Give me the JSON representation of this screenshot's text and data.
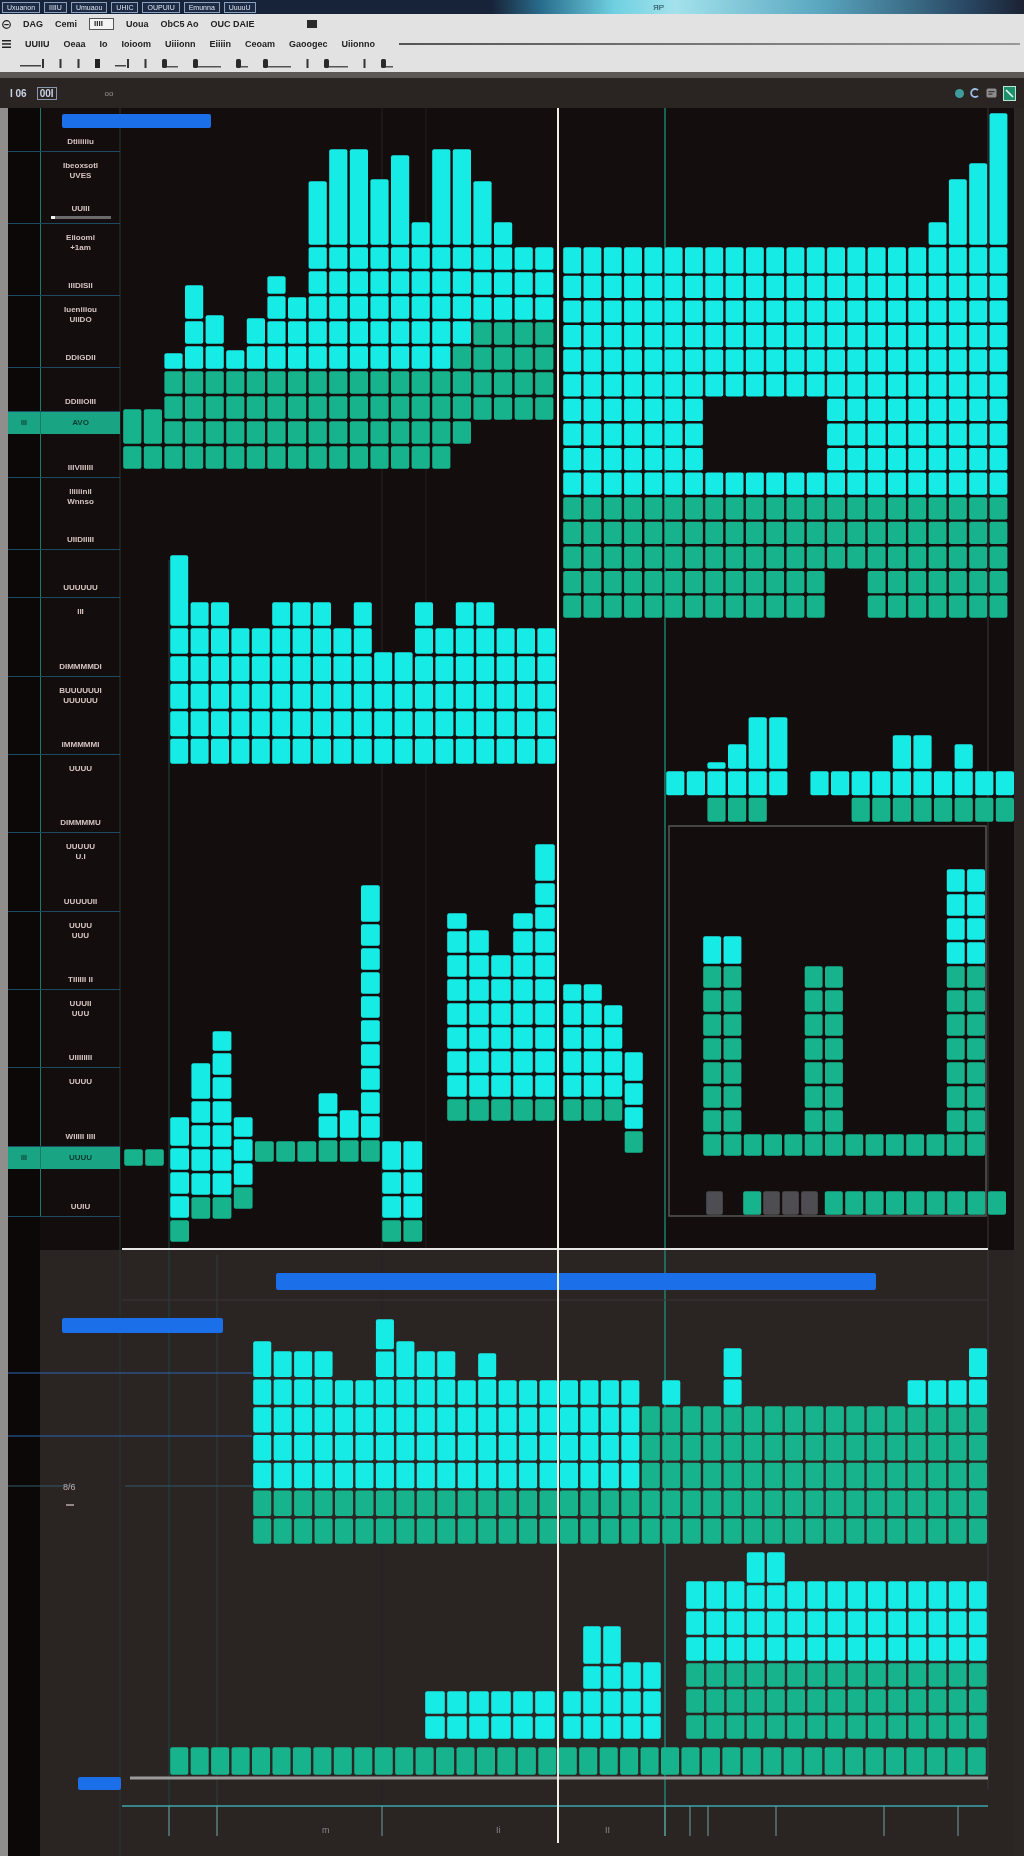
{
  "taskbar": {
    "items": [
      "Uxuanon",
      "IIIIU",
      "Umuaou",
      "UHIC",
      "OUPUIU",
      "Emunna",
      "UuuuU"
    ],
    "title": "ЯР"
  },
  "toolbar": {
    "items": [
      {
        "kind": "label",
        "text": "DAG"
      },
      {
        "kind": "label",
        "text": "Cemi"
      },
      {
        "kind": "field",
        "text": "IIII"
      },
      {
        "kind": "label",
        "text": "Uoua"
      },
      {
        "kind": "label",
        "text": "ObC5 Ao"
      },
      {
        "kind": "label",
        "text": "OUC DAIE"
      }
    ]
  },
  "menu_bar": {
    "items": [
      "UUIIU",
      "Oeaa",
      "Io",
      "Ioioom",
      "Uiiionn",
      "Eiiiin",
      "Ceoam",
      "Gaoogec",
      "Uiionno"
    ]
  },
  "header": {
    "time": "I 06",
    "counter": "00I",
    "label": "oo"
  },
  "tracks_top": [
    {
      "footer": "Dtiiiiiiu",
      "selected": false
    },
    {
      "lines": [
        "Ibeoxsotl",
        "UVES"
      ],
      "footer": "UUIII",
      "level": 0.08,
      "selected": false
    },
    {
      "lines": [
        "Eiiooml",
        "+1am"
      ],
      "footer": "IIIDISII",
      "selected": false
    },
    {
      "lines": [
        "Iueniiiou",
        "UIIDO"
      ],
      "footer": "DDIGDII",
      "selected": false
    },
    {
      "footer": "DDIIIOIII",
      "selected": false
    },
    {
      "side": "III",
      "footer": "AVO",
      "selected": true
    },
    {
      "footer": "IIIVIIIIII",
      "selected": false
    },
    {
      "lines": [
        "Iliiiinil",
        "Wnnso"
      ],
      "footer": "UIIDIIIII",
      "selected": false
    }
  ],
  "tracks_bottom": [
    {
      "footer": "UUUUUU",
      "selected": false
    },
    {
      "lines": [
        "III"
      ],
      "footer": "DIMMMMDI",
      "selected": false
    },
    {
      "lines": [
        "BUUUUUUI",
        "UUUUUU"
      ],
      "footer": "IMMMMMI",
      "selected": false
    },
    {
      "lines": [
        "UUUU"
      ],
      "footer": "DIMMMMU",
      "selected": false
    },
    {
      "lines": [
        "UUUUU",
        "U.I"
      ],
      "footer": "UUUUUII",
      "selected": false
    },
    {
      "lines": [
        "UUUU",
        "UUU"
      ],
      "footer": "TIIIIII II",
      "selected": false
    },
    {
      "lines": [
        "UUUII",
        "UUU"
      ],
      "footer": "UIIIIIIII",
      "selected": false
    },
    {
      "lines": [
        "UUUU"
      ],
      "footer": "WIIIII IIII",
      "selected": false
    },
    {
      "side": "III",
      "footer": "UUUU",
      "selected": true
    },
    {
      "footer": "UUIU",
      "selected": false
    }
  ],
  "lower_panel": {
    "label": "8/6"
  },
  "ruler": {
    "labels": [
      "m",
      "Ii",
      "II"
    ]
  }
}
